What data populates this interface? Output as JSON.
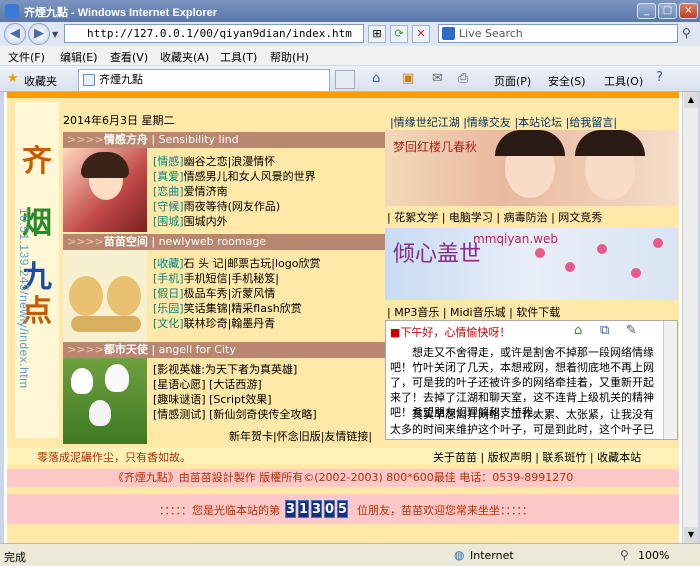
{
  "window": {
    "title": "齐煙九點 - Windows Internet Explorer",
    "minimize": "_",
    "maximize": "□",
    "close": "×"
  },
  "addressbar": {
    "url": "http://127.0.0.1/00/qiyan9dian/index.htm",
    "search_placeholder": "Live Search"
  },
  "menu": [
    "文件(F)",
    "编辑(E)",
    "查看(V)",
    "收藏夹(A)",
    "工具(T)",
    "帮助(H)"
  ],
  "favbar": {
    "favorites": "收藏夹",
    "tab_title": "齐煙九點",
    "page_menu": "页面(P)",
    "safety_menu": "安全(S)",
    "tools_menu": "工具(O)"
  },
  "page": {
    "side_title": [
      "齐",
      "烟",
      "九",
      "点"
    ],
    "side_url": "10.51.139.245/newly/index.htm",
    "date": "2014年6月3日  星期二",
    "top_links": [
      "|情缘世纪江湖",
      "|情缘交友",
      "|本站论坛",
      "|给我留言|"
    ],
    "sections": [
      {
        "title": "情感方舟",
        "subtitle": "Sensibility lind",
        "items": [
          {
            "key": "[情感]",
            "text": "幽谷之恋|浪漫情怀"
          },
          {
            "key": "[真爱]",
            "text": "情感男儿和女人风景的世界"
          },
          {
            "key": "[恋曲]",
            "text": "爱情济南"
          },
          {
            "key": "[守候]",
            "text": "雨夜等待(网友作品)"
          },
          {
            "key": "[围城]",
            "text": "围城内外"
          }
        ]
      },
      {
        "title": "苗苗空间",
        "subtitle": "newlyweb roomage",
        "items": [
          {
            "key": "[收藏]",
            "text": "石 头 记|邮票古玩|logo欣赏"
          },
          {
            "key": "[手机]",
            "text": "手机短信|手机秘笈|"
          },
          {
            "key": "[假日]",
            "text": "极品车秀|沂蒙风情"
          },
          {
            "key": "[乐园]",
            "text": "笑话集锦|精采flash欣赏"
          },
          {
            "key": "[文化]",
            "text": "联林珍奇|翰墨丹青"
          }
        ]
      },
      {
        "title": "都市天使",
        "subtitle": "angell for City",
        "items": [
          {
            "key": "[影视英雄:为天下者为真英雄]",
            "text": ""
          },
          {
            "key": "[星语心愿]",
            "text": "[大话西游]"
          },
          {
            "key": "[趣味谜语]",
            "text": "[Script效果]"
          },
          {
            "key": "[情感测试]",
            "text": "[新仙剑奇侠传全攻略]"
          }
        ],
        "bottom_links": "新年贺卡|怀念旧版|友情链接|"
      }
    ],
    "banner1_text": "梦回红楼几春秋",
    "banner1_links": "| 花絮文学 | 电脑学习 | 病毒防治 |  网文竞秀",
    "banner2_text": "倾心盖世",
    "banner2_url": "mmqiyan.web",
    "banner2_links": "| MP3音乐 | Midi音乐城 | 软件下载",
    "notice": {
      "title": "■下午好，心情愉快呀！",
      "para1": "想走又不舍得走，或许是割舍不掉那一段网络情缘吧！竹叶关闭了几天，本想戒网，想着彻底地不再上网了，可是我的叶子还被许多的网络牵挂着，又重新开起来了！去掉了江湖和聊天室，这不连背上级机关的精神吧！希望朋友们理解和支持我。",
      "para2": "其实早想离开网络，工作太累、太张紧，让我没有太多的时间来维护这个叶子，可是到此时，这个叶子已"
    },
    "footer_left": "零落成泥碾作尘，只有香如故。",
    "footer_links": "关于苗苗 | 版权声明 | 联系斑竹 | 收藏本站",
    "copyright": "《齐煙九點》由苗苗設計製作  版權所有©(2002-2003)  800*600最佳  电话：0539-8991270",
    "visitor_prefix": "：：：：：您是光临本站的第",
    "visitor_digits": [
      "3",
      "1",
      "3",
      "0",
      "5"
    ],
    "visitor_suffix": "位朋友，苗苗欢迎您常来坐坐：：：：："
  },
  "statusbar": {
    "left": "完成",
    "zone": "Internet",
    "zoom": "100%"
  },
  "colors": {
    "accent_orange": "#ff9a00",
    "section_bar": "#b98670",
    "page_bg": "#ffe8a8"
  }
}
